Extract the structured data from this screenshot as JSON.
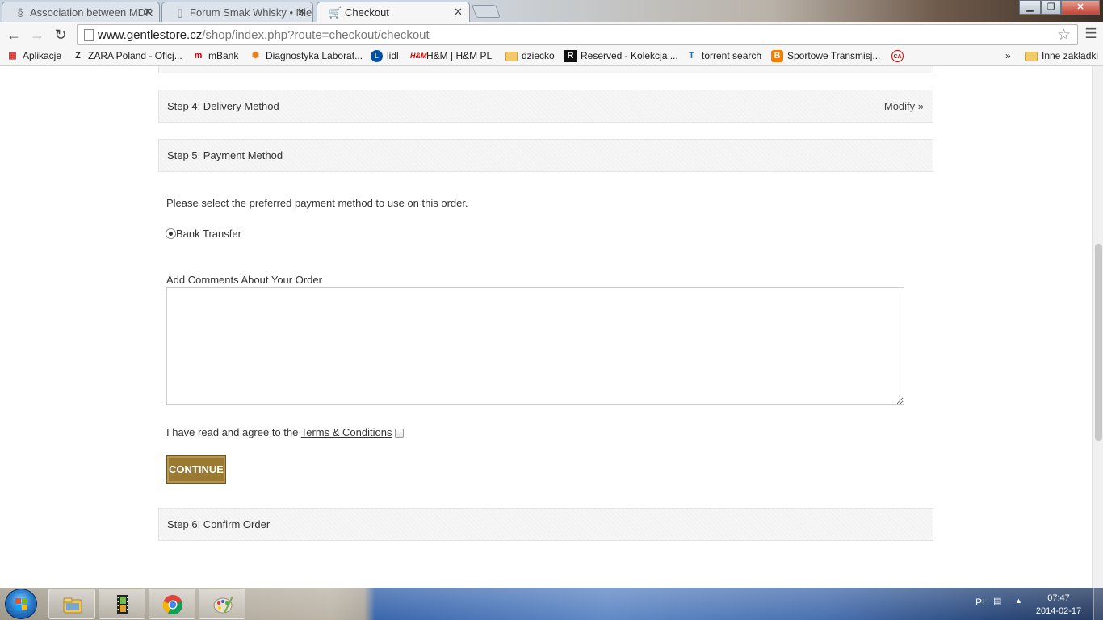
{
  "browser": {
    "tabs": [
      {
        "title": "Association between MDR",
        "active": false
      },
      {
        "title": "Forum Smak Whisky • Nie",
        "active": false
      },
      {
        "title": "Checkout",
        "active": true
      }
    ],
    "url_host": "www.gentlestore.cz",
    "url_path": "/shop/index.php?route=checkout/checkout",
    "bookmarks": [
      {
        "label": "Aplikacje",
        "icon": "apps-grid-icon"
      },
      {
        "label": "ZARA Poland - Oficj...",
        "icon": "zara-icon"
      },
      {
        "label": "mBank",
        "icon": "mbank-icon"
      },
      {
        "label": "Diagnostyka Laborat...",
        "icon": "diagnostyka-icon"
      },
      {
        "label": "lidl",
        "icon": "lidl-icon"
      },
      {
        "label": "H&M | H&M PL",
        "icon": "hm-icon"
      },
      {
        "label": "dziecko",
        "icon": "folder-icon"
      },
      {
        "label": "Reserved - Kolekcja ...",
        "icon": "reserved-icon"
      },
      {
        "label": "torrent search",
        "icon": "torrent-icon"
      },
      {
        "label": "Sportowe Transmisj...",
        "icon": "blogger-icon"
      },
      {
        "label": "",
        "icon": "ca-icon"
      }
    ],
    "overflow": "»",
    "other_bookmarks": "Inne zakładki"
  },
  "checkout": {
    "step4": {
      "title": "Step 4: Delivery Method",
      "modify": "Modify »"
    },
    "step5": {
      "title": "Step 5: Payment Method"
    },
    "payment_instruction": "Please select the preferred payment method to use on this order.",
    "payment_option": {
      "label": "Bank Transfer",
      "selected": true
    },
    "comments_label": "Add Comments About Your Order",
    "comments_value": "",
    "terms_prefix": "I have read and agree to the ",
    "terms_link": "Terms & Conditions",
    "terms_checked": false,
    "continue_label": "CONTINUE",
    "step6": {
      "title": "Step 6: Confirm Order"
    }
  },
  "taskbar": {
    "language": "PL",
    "time": "07:47",
    "date": "2014-02-17"
  },
  "colors": {
    "accent_button": "#9a7a32",
    "step_bar_bg": "#f6f6f6"
  }
}
